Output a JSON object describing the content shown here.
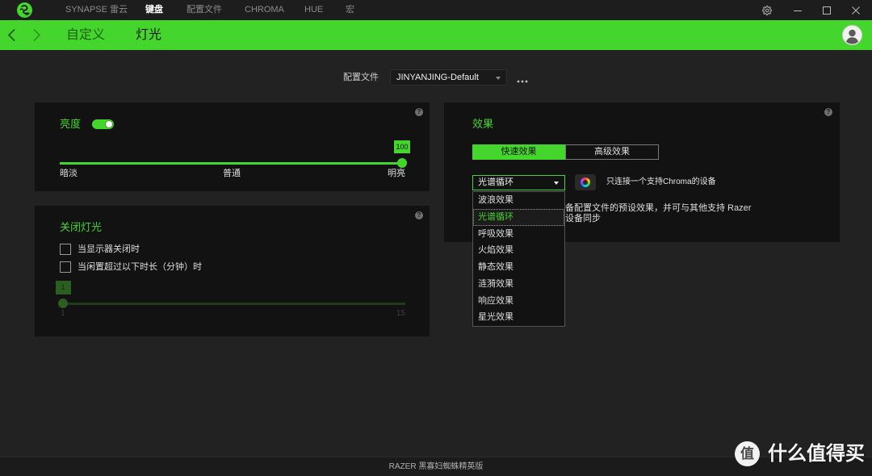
{
  "colors": {
    "accent": "#44d62c",
    "background": "#222222",
    "panel": "#121212"
  },
  "titlebar": {
    "logo_icon": "razer-logo-icon",
    "nav": [
      {
        "label": "SYNAPSE 雷云",
        "active": false
      },
      {
        "label": "键盘",
        "active": true
      },
      {
        "label": "配置文件",
        "active": false
      },
      {
        "label": "CHROMA",
        "active": false
      },
      {
        "label": "HUE",
        "active": false
      },
      {
        "label": "宏",
        "active": false
      }
    ],
    "icons": {
      "settings": "gear-icon",
      "minimize": "minimize-icon",
      "maximize": "maximize-icon",
      "close": "close-icon"
    }
  },
  "subnav": {
    "back_icon": "chevron-left-icon",
    "forward_icon": "chevron-right-icon",
    "tabs": [
      {
        "label": "自定义",
        "active": false
      },
      {
        "label": "灯光",
        "active": true
      }
    ],
    "avatar_icon": "user-avatar-icon"
  },
  "profile": {
    "label": "配置文件",
    "value": "JINYANJING-Default",
    "more_icon": "more-icon"
  },
  "brightness": {
    "title": "亮度",
    "enabled": true,
    "value": 100,
    "labels": {
      "low": "暗淡",
      "mid": "普通",
      "high": "明亮"
    },
    "help_icon": "help-icon"
  },
  "lights_off": {
    "title": "关闭灯光",
    "options": [
      {
        "label": "当显示器关闭时",
        "checked": false
      },
      {
        "label": "当闲置超过以下时长（分钟）时",
        "checked": false
      }
    ],
    "timer": {
      "value": 1,
      "min": 1,
      "max": 15
    },
    "help_icon": "help-icon"
  },
  "effects": {
    "title": "效果",
    "tabs": [
      {
        "label": "快速效果",
        "active": true
      },
      {
        "label": "高级效果",
        "active": false
      }
    ],
    "selected": "光谱循环",
    "options": [
      "波浪效果",
      "光谱循环",
      "呼吸效果",
      "火焰效果",
      "静态效果",
      "涟漪效果",
      "响应效果",
      "星光效果"
    ],
    "chroma_icon": "chroma-icon",
    "chroma_note": "只连接一个支持Chroma的设备",
    "description": [
      "备配置文件的预设效果，并可与其他支持 Razer",
      "设备同步"
    ],
    "help_icon": "help-icon"
  },
  "footer": {
    "device": "RAZER 黑寡妇蜘蛛精英版"
  },
  "watermark": {
    "badge": "值",
    "text": "什么值得买"
  }
}
